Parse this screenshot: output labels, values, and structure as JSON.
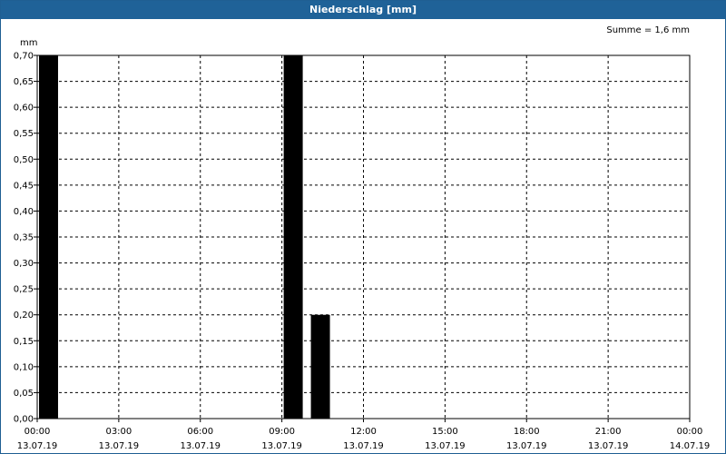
{
  "window": {
    "title": "Niederschlag [mm]"
  },
  "chart_data": {
    "type": "bar",
    "title": "Niederschlag [mm]",
    "ylabel": "mm",
    "annotation": "Summe = 1,6 mm",
    "ylim": [
      0,
      0.7
    ],
    "yticks": [
      "0,00",
      "0,05",
      "0,10",
      "0,15",
      "0,20",
      "0,25",
      "0,30",
      "0,35",
      "0,40",
      "0,45",
      "0,50",
      "0,55",
      "0,60",
      "0,65",
      "0,70"
    ],
    "xlim_hours": [
      0,
      24
    ],
    "xticks": [
      {
        "time": "00:00",
        "date": "13.07.19"
      },
      {
        "time": "03:00",
        "date": "13.07.19"
      },
      {
        "time": "06:00",
        "date": "13.07.19"
      },
      {
        "time": "09:00",
        "date": "13.07.19"
      },
      {
        "time": "12:00",
        "date": "13.07.19"
      },
      {
        "time": "15:00",
        "date": "13.07.19"
      },
      {
        "time": "18:00",
        "date": "13.07.19"
      },
      {
        "time": "21:00",
        "date": "13.07.19"
      },
      {
        "time": "00:00",
        "date": "14.07.19"
      }
    ],
    "bars": [
      {
        "time": "00:00",
        "value": 0.7
      },
      {
        "time": "09:00",
        "value": 0.7
      },
      {
        "time": "10:00",
        "value": 0.2
      }
    ],
    "grid": true,
    "bar_color": "#000000"
  }
}
